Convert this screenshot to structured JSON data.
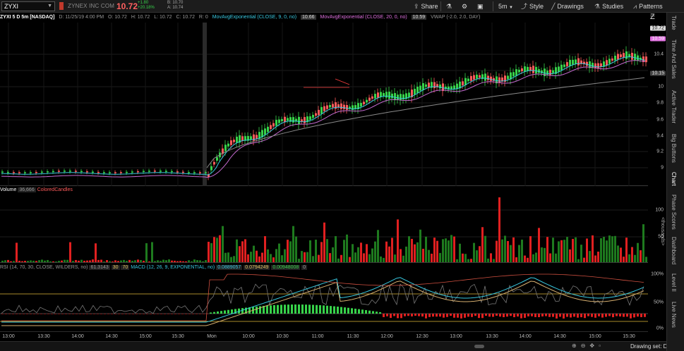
{
  "toolbar": {
    "symbol": "ZYXI",
    "company": "ZYNEX INC COM",
    "last": "10.72",
    "change": "+1.80",
    "change_pct": "+20.18%",
    "bid": "B: 10.70",
    "ask": "A: 10.74",
    "share_label": "Share",
    "timeframe": "5m",
    "style_label": "Style",
    "drawings_label": "Drawings",
    "studies_label": "Studies",
    "patterns_label": "Patterns"
  },
  "info": {
    "title": "ZYXI 5 D 5m [NASDAQ]",
    "datetime": "D: 11/25/19 4:00 PM",
    "open": "O: 10.72",
    "high": "H: 10.72",
    "low": "L: 10.72",
    "close": "C: 10.72",
    "range": "R: 0",
    "ema9_label": "MovAvgExponential (CLOSE, 9, 0, no)",
    "ema9_value": "10.66",
    "ema20_label": "MovAvgExponential (CLOSE, 20, 0, no)",
    "ema20_value": "10.59",
    "vwap_label": "VWAP (-2.0, 2.0, DAY)"
  },
  "price_axis": {
    "ticks": [
      "10.4",
      "10.2",
      "10",
      "9.8",
      "9.6",
      "9.4",
      "9.2",
      "9"
    ],
    "tag_last": "10.72",
    "tag_ema": "10.59",
    "tag_vwap": "10.15"
  },
  "volume": {
    "label": "Volume",
    "value": "36,666",
    "study": "ColoredCandles",
    "ticks": [
      "100",
      "50"
    ],
    "unit": "<thousands>"
  },
  "rsi": {
    "label": "RSI (14, 70, 30, CLOSE, WILDERS, no)",
    "value": "61.3143",
    "ob": "30",
    "os": "70",
    "macd_label": "MACD (12, 26, 9, EXPONENTIAL, no)",
    "macd_value": "0.0889057",
    "macd_avg": "0.0794249",
    "macd_diff": "0.00948008",
    "macd_zero": "0",
    "ticks": [
      "100%",
      "50%",
      "0%"
    ]
  },
  "time_axis": [
    "13:00",
    "13:30",
    "14:00",
    "14:30",
    "15:00",
    "15:30",
    "Mon",
    "10:00",
    "10:30",
    "11:00",
    "11:30",
    "12:00",
    "12:30",
    "13:00",
    "13:30",
    "14:00",
    "14:30",
    "15:00",
    "15:30"
  ],
  "sidebar_tabs": [
    "Trade",
    "Time And Sales",
    "Active Trader",
    "Big Buttons",
    "Chart",
    "Phase Scores",
    "Dashboard",
    "Level II",
    "Live News"
  ],
  "bottom": {
    "drawing_set": "Drawing set: Default"
  },
  "colors": {
    "up": "#37d24a",
    "down": "#ff5b5b",
    "ema9": "#38c8e0",
    "ema20": "#c56ad0",
    "vwap": "#8a8a8a"
  }
}
